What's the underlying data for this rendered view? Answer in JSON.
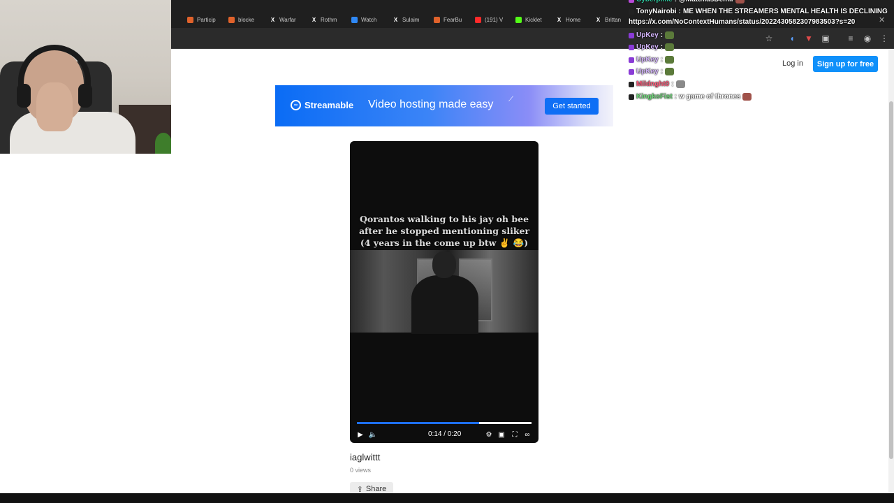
{
  "tabs": [
    {
      "label": "Particip",
      "favicon": "streamable-icon",
      "color": "#e0622b"
    },
    {
      "label": "blocke",
      "favicon": "streamable-icon",
      "color": "#e0622b"
    },
    {
      "label": "Warfar",
      "favicon": "x-icon",
      "color": "#ffffff"
    },
    {
      "label": "Rothm",
      "favicon": "x-icon",
      "color": "#ffffff"
    },
    {
      "label": "Watch",
      "favicon": "streamable-icon",
      "color": "#2f88f5"
    },
    {
      "label": "Sulaim",
      "favicon": "x-icon",
      "color": "#ffffff"
    },
    {
      "label": "FearBu",
      "favicon": "streamable-icon",
      "color": "#e0622b"
    },
    {
      "label": "(191) V",
      "favicon": "youtube-icon",
      "color": "#ff2a2a"
    },
    {
      "label": "Kicklet",
      "favicon": "kick-icon",
      "color": "#53fc18"
    },
    {
      "label": "Home",
      "favicon": "x-icon",
      "color": "#ffffff"
    },
    {
      "label": "Brittan",
      "favicon": "x-icon",
      "color": "#ffffff"
    }
  ],
  "header": {
    "login": "Log in",
    "signup": "Sign up for free"
  },
  "banner": {
    "brand": "Streamable",
    "tagline": "Video hosting made easy",
    "cta": "Get started"
  },
  "video": {
    "caption_lines": [
      "Qorantos walking to his jay oh bee",
      "after he stopped mentioning sliker",
      "(4 years in the come up btw ✌ 😂)"
    ],
    "time": "0:14 / 0:20",
    "progress": 0.7,
    "title": "iaglwittt",
    "views": "0 views",
    "share": "Share"
  },
  "chat": [
    {
      "user": "Cyberphile",
      "sep": " : ",
      "text": "@MatthiasDemil",
      "user_color": "#2fcfa4",
      "badge": "#b84ad9"
    },
    {
      "user": "TonyNairobi",
      "sep": " : ",
      "text": "ME WHEN THE STREAMERS MENTAL HEALTH IS DECLINING",
      "user_color": "#ffffff",
      "badge": "#222222"
    },
    {
      "user": "",
      "sep": "",
      "text": "https://x.com/NoContextHumans/status/2022430582307983503?s=20",
      "user_color": "#ffffff",
      "badge": ""
    },
    {
      "user": "UpKey",
      "sep": " : ",
      "text": "",
      "user_color": "#d7b8ff",
      "badge": "#8a3bd6"
    },
    {
      "user": "UpKey",
      "sep": " : ",
      "text": "",
      "user_color": "#d7b8ff",
      "badge": "#8a3bd6"
    },
    {
      "user": "UpKey",
      "sep": " : ",
      "text": "",
      "user_color": "#d7b8ff",
      "badge": "#8a3bd6"
    },
    {
      "user": "UpKey",
      "sep": " : ",
      "text": "",
      "user_color": "#d7b8ff",
      "badge": "#8a3bd6"
    },
    {
      "user": "Mildnght0",
      "sep": " : ",
      "text": "",
      "user_color": "#ff5a7a",
      "badge": "#222222"
    },
    {
      "user": "KingkoFist",
      "sep": " : ",
      "text": "w game of thrones",
      "user_color": "#6fdc7a",
      "badge": "#222222"
    }
  ],
  "colors": {
    "accent": "#0f90fa",
    "progress": "#1e6ff0"
  }
}
